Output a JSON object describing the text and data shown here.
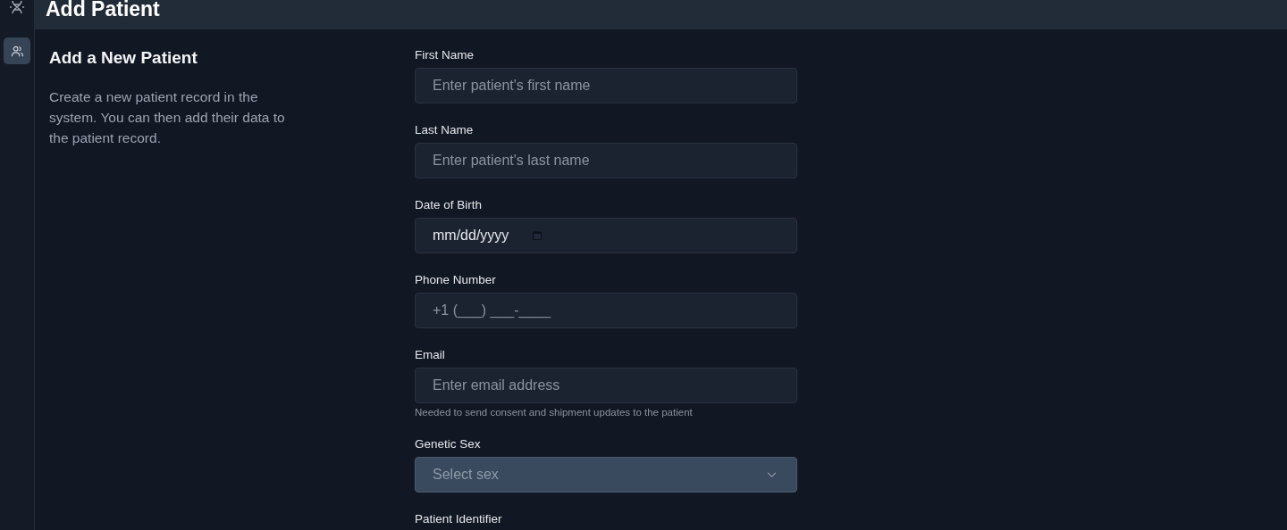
{
  "header": {
    "title": "Add Patient"
  },
  "sidebar": {
    "items": [
      {
        "selected": true
      }
    ]
  },
  "intro": {
    "heading": "Add a New Patient",
    "description": "Create a new patient record in the system. You can then add their data to the patient record."
  },
  "fields": [
    {
      "kind": "text",
      "label": "First Name",
      "placeholder": "Enter patient's first name"
    },
    {
      "kind": "text",
      "label": "Last Name",
      "placeholder": "Enter patient's last name"
    },
    {
      "kind": "date",
      "label": "Date of Birth",
      "value": "mm/dd/yyyy"
    },
    {
      "kind": "text",
      "label": "Phone Number",
      "placeholder": "+1 (___) ___-____"
    },
    {
      "kind": "text",
      "label": "Email",
      "placeholder": "Enter email address",
      "hint": "Needed to send consent and shipment updates to the patient"
    },
    {
      "kind": "select",
      "label": "Genetic Sex",
      "placeholder": "Select sex"
    },
    {
      "kind": "label",
      "label": "Patient Identifier"
    }
  ]
}
